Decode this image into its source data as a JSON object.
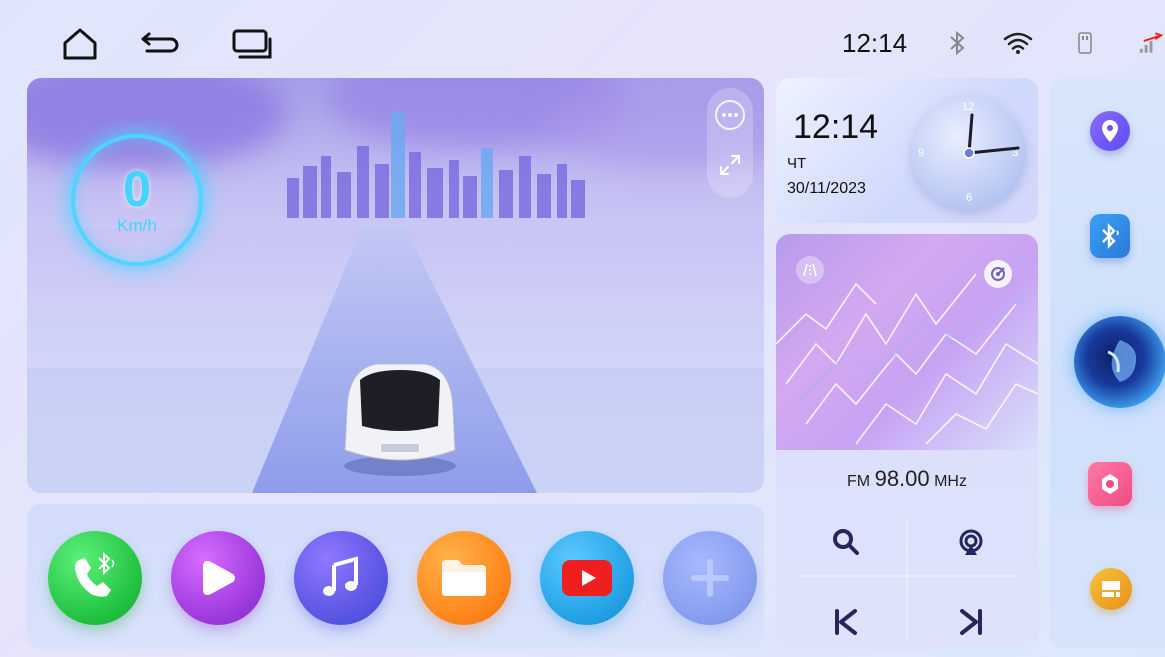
{
  "status_bar": {
    "time": "12:14",
    "icons": [
      "home-icon",
      "back-icon",
      "recents-icon",
      "bluetooth-icon",
      "wifi-icon",
      "usb-icon",
      "signal-icon"
    ]
  },
  "speedometer": {
    "value": "0",
    "unit": "Km/h"
  },
  "clock_widget": {
    "time": "12:14",
    "day": "ЧТ",
    "date": "30/11/2023",
    "dial_numbers": [
      "12",
      "3",
      "6",
      "9"
    ]
  },
  "radio": {
    "band": "FM",
    "frequency": "98.00",
    "unit": "MHz"
  },
  "apps": [
    {
      "name": "bluetooth-phone",
      "color": "#2ecc40"
    },
    {
      "name": "video-player",
      "color": "#a43ee0"
    },
    {
      "name": "music",
      "color": "#5e58e6"
    },
    {
      "name": "file-manager",
      "color": "#ff8a1e"
    },
    {
      "name": "youtube",
      "color": "#27a6e8"
    },
    {
      "name": "add",
      "color": "#8aa0f0"
    }
  ],
  "dock": {
    "items": [
      "navigation",
      "bluetooth",
      "voice-assistant",
      "settings",
      "split-screen"
    ]
  }
}
